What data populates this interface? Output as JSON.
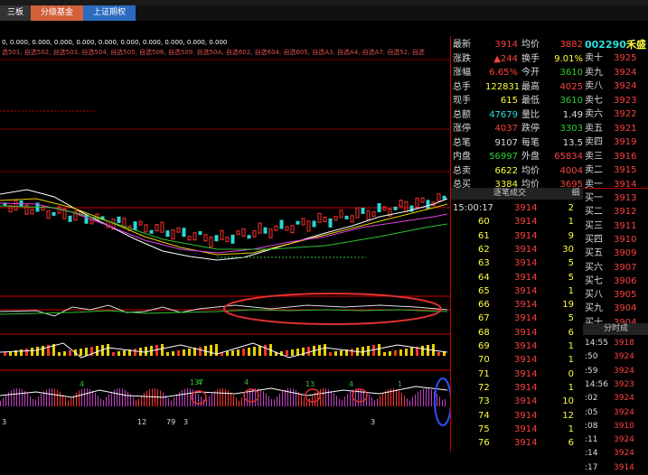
{
  "tabs": [
    {
      "label": "三板"
    },
    {
      "label": "分级基金"
    },
    {
      "label": "上证期权"
    }
  ],
  "indicator_line": "0, 0.000, 0.000, 0.000, 0.000, 0.000, 0.000, 0.000, 0.000, 0.000, 0.000",
  "selection_line": "选501, 自选502, 自选503, 自选504, 自选505, 自选506, 自选509, 自选50A, 自选602, 自选604, 自选605, 自选A3, 自选A4, 自选A7, 自选52, 自选",
  "stock": {
    "code": "002290",
    "name": "禾盛"
  },
  "quote_left": [
    {
      "label": "最新",
      "value": "3914",
      "color": "red"
    },
    {
      "label": "涨跌",
      "value": "▲244",
      "color": "red"
    },
    {
      "label": "涨幅",
      "value": "6.65%",
      "color": "red"
    },
    {
      "label": "总手",
      "value": "122831",
      "color": "yellow"
    },
    {
      "label": "现手",
      "value": "615",
      "color": "yellow"
    },
    {
      "label": "总额",
      "value": "47679",
      "color": "cyan"
    },
    {
      "label": "涨停",
      "value": "4037",
      "color": "red"
    },
    {
      "label": "总笔",
      "value": "9107",
      "color": "white"
    },
    {
      "label": "内盘",
      "value": "56997",
      "color": "green"
    },
    {
      "label": "总卖",
      "value": "6622",
      "color": "yellow"
    },
    {
      "label": "总买",
      "value": "3384",
      "color": "yellow"
    }
  ],
  "quote_right": [
    {
      "label": "均价",
      "value": "3882",
      "color": "red"
    },
    {
      "label": "换手",
      "value": "9.01%",
      "color": "yellow"
    },
    {
      "label": "今开",
      "value": "3610",
      "color": "green"
    },
    {
      "label": "最高",
      "value": "4025",
      "color": "red"
    },
    {
      "label": "最低",
      "value": "3610",
      "color": "green"
    },
    {
      "label": "量比",
      "value": "1.49",
      "color": "white"
    },
    {
      "label": "跌停",
      "value": "3303",
      "color": "green"
    },
    {
      "label": "每笔",
      "value": "13.5",
      "color": "white"
    },
    {
      "label": "外盘",
      "value": "65834",
      "color": "red"
    },
    {
      "label": "均价",
      "value": "4004",
      "color": "red"
    },
    {
      "label": "均价",
      "value": "3695",
      "color": "red"
    }
  ],
  "sell_orders": [
    {
      "label": "卖十",
      "price": "3925"
    },
    {
      "label": "卖九",
      "price": "3924"
    },
    {
      "label": "卖八",
      "price": "3924"
    },
    {
      "label": "卖七",
      "price": "3923"
    },
    {
      "label": "卖六",
      "price": "3922"
    },
    {
      "label": "卖五",
      "price": "3921"
    },
    {
      "label": "卖四",
      "price": "3919"
    },
    {
      "label": "卖三",
      "price": "3916"
    },
    {
      "label": "卖二",
      "price": "3915"
    },
    {
      "label": "卖一",
      "price": "3914"
    }
  ],
  "buy_orders": [
    {
      "label": "买一",
      "price": "3913"
    },
    {
      "label": "买二",
      "price": "3912"
    },
    {
      "label": "买三",
      "price": "3911"
    },
    {
      "label": "买四",
      "price": "3910"
    },
    {
      "label": "买五",
      "price": "3909"
    },
    {
      "label": "买六",
      "price": "3907"
    },
    {
      "label": "买七",
      "price": "3906"
    },
    {
      "label": "买八",
      "price": "3905"
    },
    {
      "label": "买九",
      "price": "3904"
    },
    {
      "label": "买十",
      "price": "3904"
    }
  ],
  "tick_header": {
    "title": "逐笔成交",
    "tab": "细"
  },
  "ticks": [
    {
      "time": "15:00:17",
      "price": "3914",
      "vol": "2"
    },
    {
      "time": "60",
      "price": "3914",
      "vol": "1"
    },
    {
      "time": "61",
      "price": "3914",
      "vol": "9"
    },
    {
      "time": "62",
      "price": "3914",
      "vol": "30"
    },
    {
      "time": "63",
      "price": "3914",
      "vol": "5"
    },
    {
      "time": "64",
      "price": "3914",
      "vol": "5"
    },
    {
      "time": "65",
      "price": "3914",
      "vol": "1"
    },
    {
      "time": "66",
      "price": "3914",
      "vol": "19"
    },
    {
      "time": "67",
      "price": "3914",
      "vol": "5"
    },
    {
      "time": "68",
      "price": "3914",
      "vol": "6"
    },
    {
      "time": "69",
      "price": "3914",
      "vol": "1"
    },
    {
      "time": "70",
      "price": "3914",
      "vol": "1"
    },
    {
      "time": "71",
      "price": "3914",
      "vol": "0"
    },
    {
      "time": "72",
      "price": "3914",
      "vol": "1"
    },
    {
      "time": "73",
      "price": "3914",
      "vol": "10"
    },
    {
      "time": "74",
      "price": "3914",
      "vol": "12"
    },
    {
      "time": "75",
      "price": "3914",
      "vol": "1"
    },
    {
      "time": "76",
      "price": "3914",
      "vol": "6"
    }
  ],
  "minute_header": "分时成",
  "minute_ticks": [
    {
      "time": "14:55",
      "price": "3918"
    },
    {
      "time": ":50",
      "price": "3924"
    },
    {
      "time": ":59",
      "price": "3924"
    },
    {
      "time": "14:56",
      "price": "3923"
    },
    {
      "time": ":02",
      "price": "3924"
    },
    {
      "time": ":05",
      "price": "3924"
    },
    {
      "time": ":08",
      "price": "3910"
    },
    {
      "time": ":11",
      "price": "3924"
    },
    {
      "time": ":14",
      "price": "3924"
    },
    {
      "time": ":17",
      "price": "3914"
    }
  ],
  "sub_labels": [
    {
      "text": "4"
    },
    {
      "text": "4"
    },
    {
      "text": "13"
    },
    {
      "text": "4"
    },
    {
      "text": "3"
    },
    {
      "text": "12"
    },
    {
      "text": "79"
    },
    {
      "text": "3"
    },
    {
      "text": "3"
    },
    {
      "text": "137"
    },
    {
      "text": "4"
    },
    {
      "text": "1"
    }
  ]
}
